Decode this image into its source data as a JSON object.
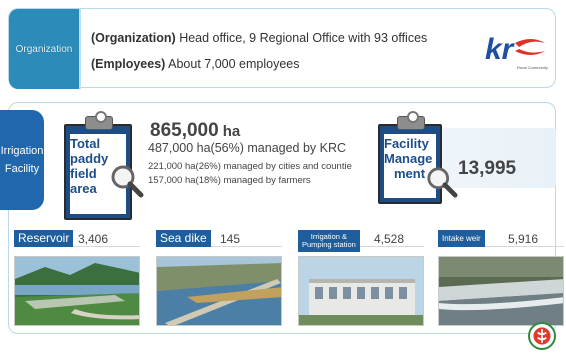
{
  "organization": {
    "tab_label": "Organization",
    "line1_bold": "(Organization)",
    "line1_text": "Head office, 9 Regional Office with 93 offices",
    "line2_bold": "(Employees)",
    "line2_text": "About 7,000 employees"
  },
  "logo": {
    "text": "kr",
    "tagline": "Korea Rural Community Corporation"
  },
  "irrigation": {
    "tab_line1": "Irrigation",
    "tab_line2": "Facility",
    "paddy_label_1": "Total",
    "paddy_label_2": "paddy",
    "paddy_label_3": "field",
    "paddy_label_4": "area",
    "total_value": "865,000",
    "total_unit": "ha",
    "krc_line": "487,000 ha(56%)  managed by KRC",
    "cities_line": "221,000 ha(26%) managed by cities and countie",
    "farmers_line": "157,000 ha(18%) managed by farmers",
    "mgmt_label_1": "Facility",
    "mgmt_label_2": "Manage",
    "mgmt_label_3": "ment",
    "facility_total": "13,995"
  },
  "facilities": [
    {
      "label": "Reservoir",
      "count": "3,406"
    },
    {
      "label": "Sea dike",
      "count": "145"
    },
    {
      "label_1": "Irrigation &",
      "label_2": "Pumping station",
      "count": "4,528"
    },
    {
      "label": "Intake weir",
      "count": "5,916"
    }
  ],
  "colors": {
    "accent": "#2c8bb8",
    "dark_blue": "#1f5e9c",
    "logo_red": "#e0322b"
  }
}
